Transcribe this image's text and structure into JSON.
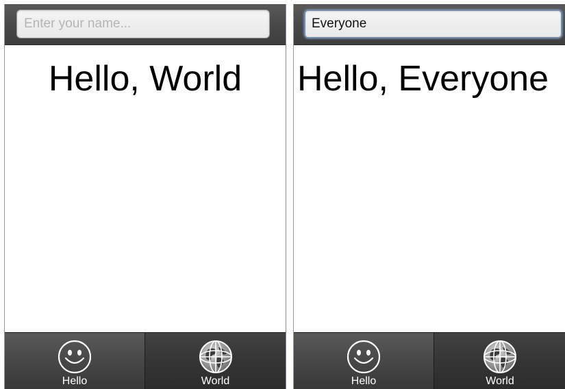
{
  "panels": [
    {
      "input": {
        "value": "",
        "placeholder": "Enter your name..."
      },
      "greeting": "Hello, World",
      "tabs": [
        {
          "label": "Hello",
          "icon": "smiley-icon",
          "active": true
        },
        {
          "label": "World",
          "icon": "globe-icon",
          "active": false
        }
      ]
    },
    {
      "input": {
        "value": "Everyone",
        "placeholder": "Enter your name..."
      },
      "greeting": "Hello, Everyone",
      "tabs": [
        {
          "label": "Hello",
          "icon": "smiley-icon",
          "active": true
        },
        {
          "label": "World",
          "icon": "globe-icon",
          "active": false
        }
      ]
    }
  ],
  "colors": {
    "topbar": "#4a4a4a",
    "tabbar_active": "#474747",
    "tabbar_inactive": "#353535",
    "input_focus_border": "#6f8fb8"
  }
}
